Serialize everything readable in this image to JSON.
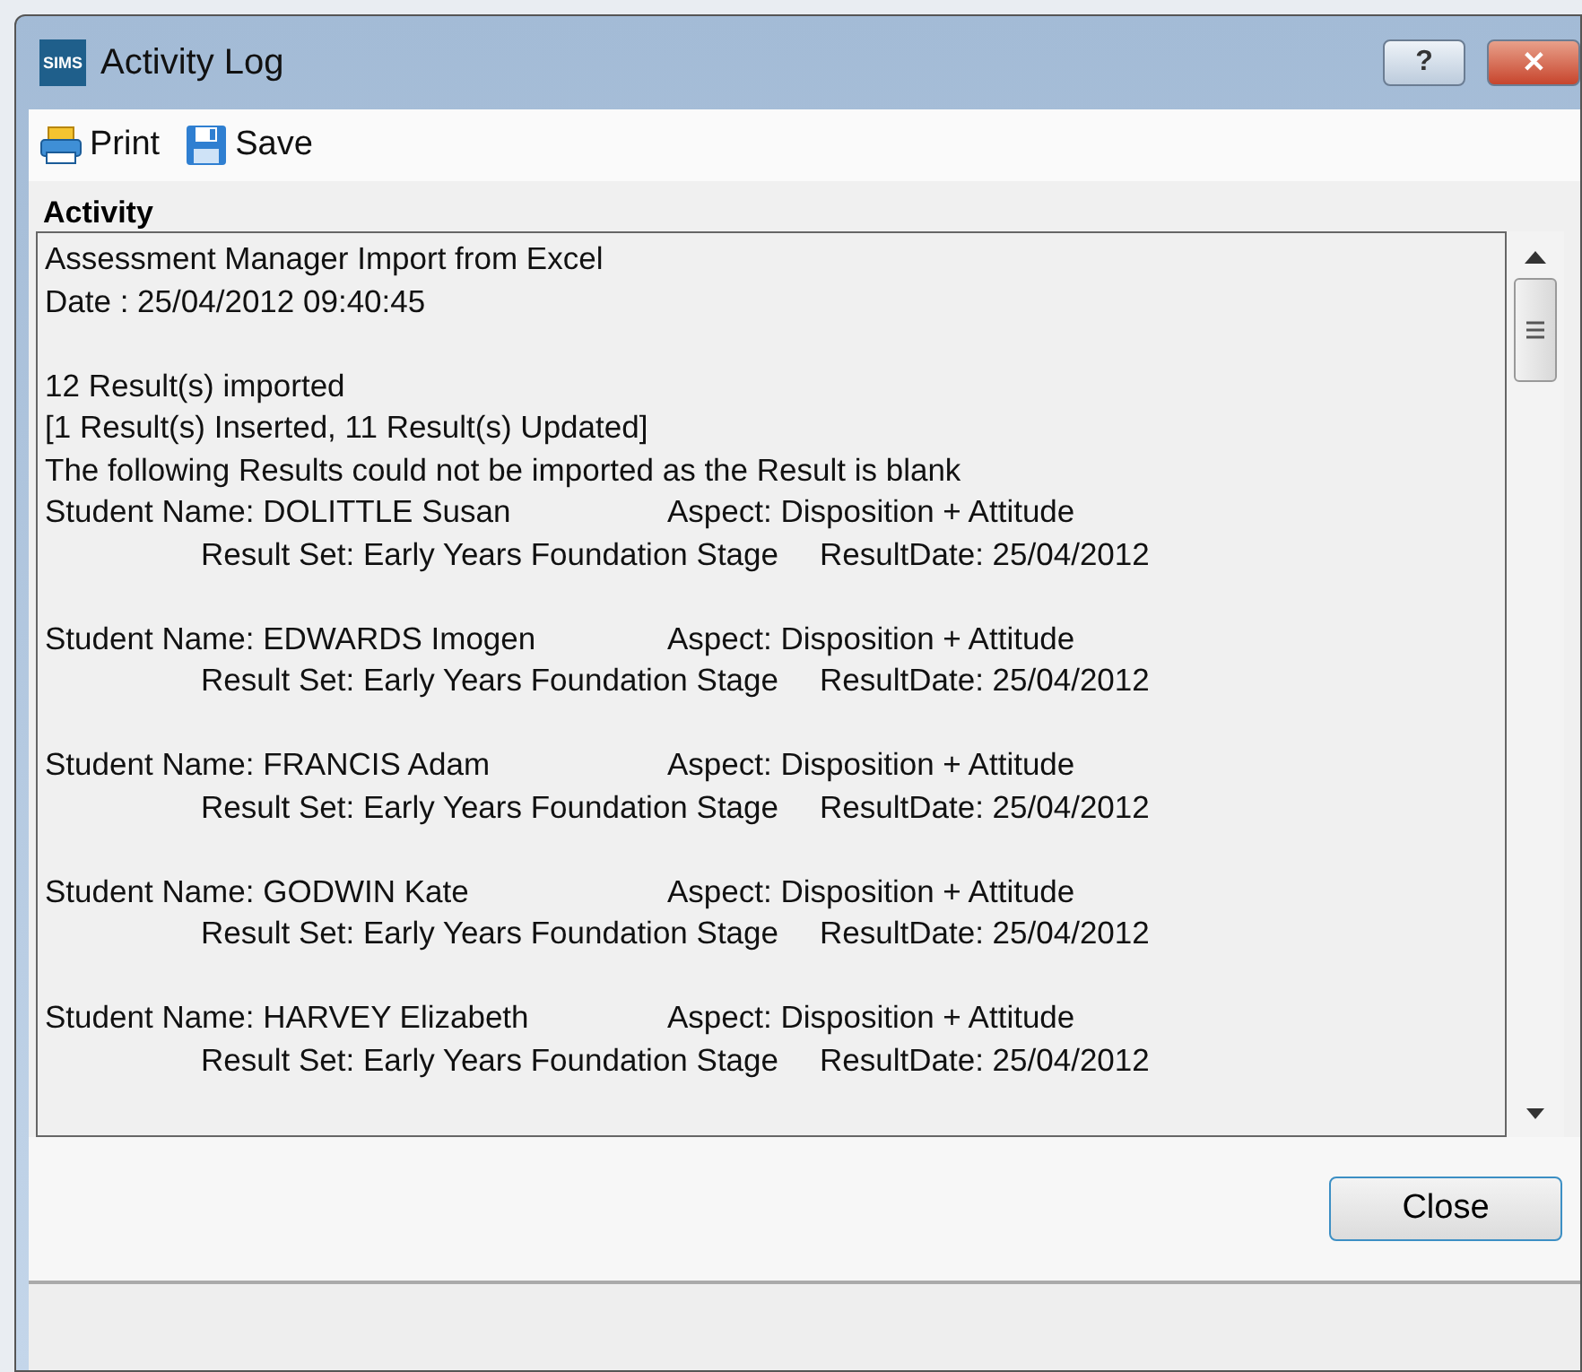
{
  "window": {
    "logo": "SIMS",
    "title": "Activity Log",
    "buttons": [
      {
        "kind": "help",
        "label": "?"
      },
      {
        "kind": "close",
        "label": "✕"
      }
    ]
  },
  "toolbar": [
    {
      "kind": "print",
      "label": "Print"
    },
    {
      "kind": "save",
      "label": "Save"
    }
  ],
  "activity": {
    "heading": "Activity",
    "intro": [
      "Assessment Manager Import from Excel",
      "Date : 25/04/2012 09:40:45"
    ],
    "summary": [
      "12 Result(s) imported",
      "[1 Result(s) Inserted, 11 Result(s) Updated]",
      "The following Results could not be imported as the Result is blank"
    ],
    "records": [
      {
        "student": "Student Name: DOLITTLE Susan",
        "aspect": "Aspect: Disposition + Attitude",
        "result_set": "Result Set: Early Years Foundation Stage",
        "result_date": "ResultDate: 25/04/2012"
      },
      {
        "student": "Student Name: EDWARDS Imogen",
        "aspect": "Aspect: Disposition + Attitude",
        "result_set": "Result Set: Early Years Foundation Stage",
        "result_date": "ResultDate: 25/04/2012"
      },
      {
        "student": "Student Name: FRANCIS Adam",
        "aspect": "Aspect: Disposition + Attitude",
        "result_set": "Result Set: Early Years Foundation Stage",
        "result_date": "ResultDate: 25/04/2012"
      },
      {
        "student": "Student Name: GODWIN Kate",
        "aspect": "Aspect: Disposition + Attitude",
        "result_set": "Result Set: Early Years Foundation Stage",
        "result_date": "ResultDate: 25/04/2012"
      },
      {
        "student": "Student Name: HARVEY Elizabeth",
        "aspect": "Aspect: Disposition + Attitude",
        "result_set": "Result Set: Early Years Foundation Stage",
        "result_date": "ResultDate: 25/04/2012"
      }
    ]
  },
  "footer": {
    "close_button": "Close"
  }
}
